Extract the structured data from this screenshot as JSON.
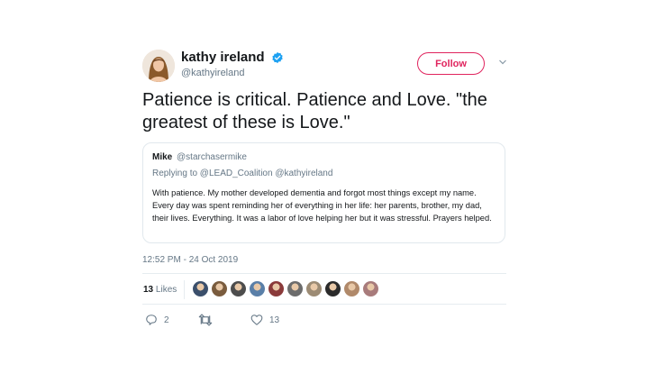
{
  "author": {
    "display_name": "kathy ireland",
    "handle": "@kathyireland",
    "verified": true
  },
  "follow_button": {
    "label": "Follow"
  },
  "tweet": {
    "text": "Patience is critical. Patience and Love. \"the greatest of these is Love.\""
  },
  "quoted_tweet": {
    "author_name": "Mike",
    "author_handle": "@starchasermike",
    "replying_to": "Replying to @LEAD_Coalition @kathyireland",
    "text": "With patience. My mother developed dementia and forgot most things except my name. Every day was spent reminding her of everything in her life: her parents, brother, my dad, their lives. Everything. It was a labor of love helping her but it was stressful. Prayers helped."
  },
  "timestamp": "12:52 PM - 24 Oct 2019",
  "likes": {
    "count": "13",
    "label": "Likes"
  },
  "likers": [
    {
      "color": "#3b4f6b"
    },
    {
      "color": "#7a5c3e"
    },
    {
      "color": "#4d4d4d"
    },
    {
      "color": "#5a7fa8"
    },
    {
      "color": "#8a3a3a"
    },
    {
      "color": "#6c6c6c"
    },
    {
      "color": "#9c8b74"
    },
    {
      "color": "#2b2b2b"
    },
    {
      "color": "#b0896a"
    },
    {
      "color": "#a87b7b"
    }
  ],
  "actions": {
    "reply_count": "2",
    "retweet_count": "",
    "like_count": "13"
  },
  "colors": {
    "accent": "#e0245e",
    "verified": "#1da1f2",
    "secondary_text": "#657786",
    "border": "#e1e8ed"
  }
}
